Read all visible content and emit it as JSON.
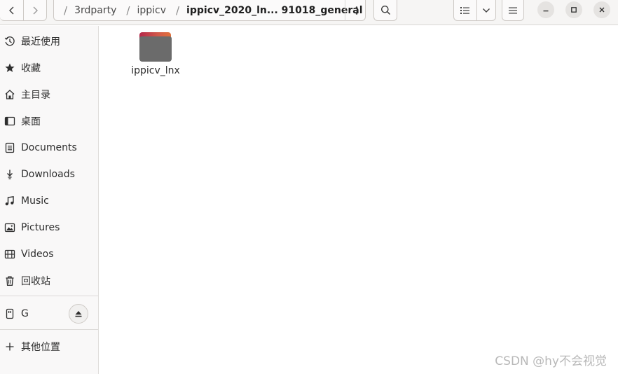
{
  "header": {
    "path": [
      {
        "label": "3rdparty"
      },
      {
        "label": "ippicv"
      },
      {
        "label": "ippicv_2020_ln... 91018_general",
        "current": true
      }
    ]
  },
  "sidebar": {
    "items": [
      {
        "label": "最近使用",
        "icon": "clock-icon"
      },
      {
        "label": "收藏",
        "icon": "star-icon"
      },
      {
        "label": "主目录",
        "icon": "home-icon"
      },
      {
        "label": "桌面",
        "icon": "desktop-icon"
      },
      {
        "label": "Documents",
        "icon": "document-icon"
      },
      {
        "label": "Downloads",
        "icon": "download-icon"
      },
      {
        "label": "Music",
        "icon": "music-icon"
      },
      {
        "label": "Pictures",
        "icon": "picture-icon"
      },
      {
        "label": "Videos",
        "icon": "video-icon"
      },
      {
        "label": "回收站",
        "icon": "trash-icon"
      }
    ],
    "drive": {
      "label": "G",
      "icon": "usb-drive-icon"
    },
    "other": {
      "label": "其他位置",
      "icon": "plus-icon"
    }
  },
  "content": {
    "files": [
      {
        "name": "ippicv_lnx",
        "type": "folder"
      }
    ]
  },
  "watermark": "CSDN @hy不会视觉",
  "colors": {
    "folder_body": "#6b6b6b",
    "folder_tab": "#d2404a",
    "sidebar_bg": "#f9f8f8",
    "header_bg": "#f6f5f4"
  }
}
